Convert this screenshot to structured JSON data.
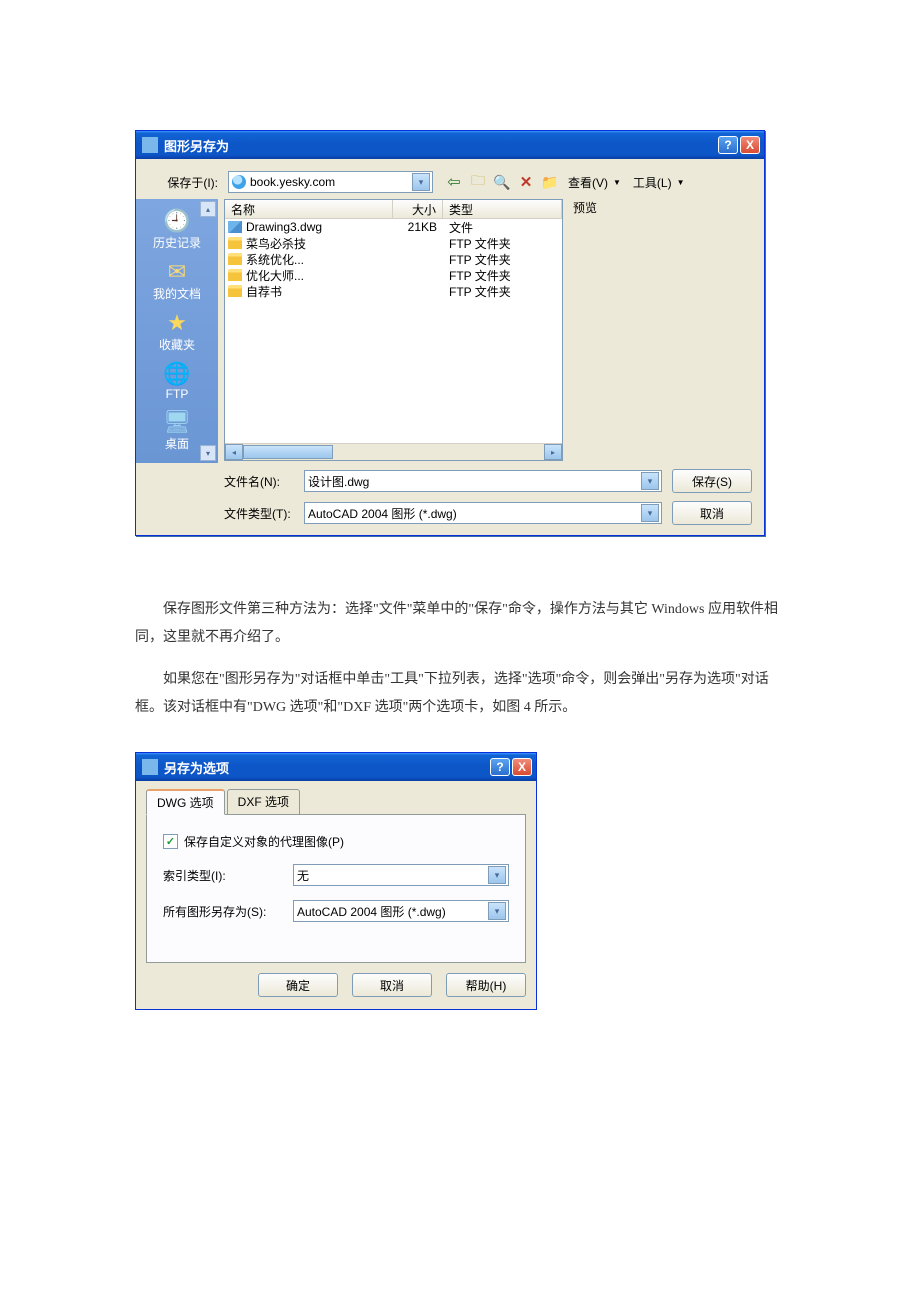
{
  "dialog1": {
    "title": "图形另存为",
    "saveInLabel": "保存于(I):",
    "saveInValue": "book.yesky.com",
    "toolbar": {
      "back": "⇦",
      "up": "🗀",
      "search": "🔍",
      "delete": "✕",
      "newFolder": "📁",
      "viewLabel": "查看(V)",
      "toolsLabel": "工具(L)"
    },
    "previewLabel": "预览",
    "places": [
      {
        "id": "history",
        "label": "历史记录",
        "iconClass": "pi-hist",
        "glyph": "🕘"
      },
      {
        "id": "mydocs",
        "label": "我的文档",
        "iconClass": "pi-docs",
        "glyph": "✉"
      },
      {
        "id": "fav",
        "label": "收藏夹",
        "iconClass": "pi-fav",
        "glyph": "★"
      },
      {
        "id": "ftp",
        "label": "FTP",
        "iconClass": "pi-ftp",
        "glyph": "🌐"
      },
      {
        "id": "desktop",
        "label": "桌面",
        "iconClass": "pi-desk",
        "glyph": "🖥"
      }
    ],
    "columns": {
      "name": "名称",
      "size": "大小",
      "type": "类型"
    },
    "rows": [
      {
        "icon": "fi-dwg",
        "name": "Drawing3.dwg",
        "size": "21KB",
        "type": "文件"
      },
      {
        "icon": "fi-folder",
        "name": "菜鸟必杀技",
        "size": "",
        "type": "FTP 文件夹"
      },
      {
        "icon": "fi-folder",
        "name": "系统优化...",
        "size": "",
        "type": "FTP 文件夹"
      },
      {
        "icon": "fi-folder",
        "name": "优化大师...",
        "size": "",
        "type": "FTP 文件夹"
      },
      {
        "icon": "fi-folder",
        "name": "自荐书",
        "size": "",
        "type": "FTP 文件夹"
      }
    ],
    "filenameLabel": "文件名(N):",
    "filenameValue": "设计图.dwg",
    "filetypeLabel": "文件类型(T):",
    "filetypeValue": "AutoCAD 2004 图形 (*.dwg)",
    "saveBtn": "保存(S)",
    "cancelBtn": "取消"
  },
  "doc": {
    "p1": "保存图形文件第三种方法为：选择\"文件\"菜单中的\"保存\"命令，操作方法与其它 Windows 应用软件相同，这里就不再介绍了。",
    "p2": "如果您在\"图形另存为\"对话框中单击\"工具\"下拉列表，选择\"选项\"命令，则会弹出\"另存为选项\"对话框。该对话框中有\"DWG 选项\"和\"DXF 选项\"两个选项卡，如图 4 所示。"
  },
  "dialog2": {
    "title": "另存为选项",
    "tabs": {
      "dwg": "DWG 选项",
      "dxf": "DXF 选项"
    },
    "checkboxLabel": "保存自定义对象的代理图像(P)",
    "checkboxChecked": true,
    "indexLabel": "索引类型(I):",
    "indexValue": "无",
    "allSaveLabel": "所有图形另存为(S):",
    "allSaveValue": "AutoCAD 2004 图形 (*.dwg)",
    "okBtn": "确定",
    "cancelBtn": "取消",
    "helpBtn": "帮助(H)"
  }
}
